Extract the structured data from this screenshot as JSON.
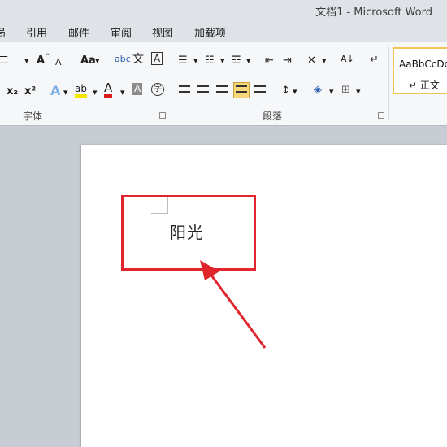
{
  "window": {
    "title": "文档1 - Microsoft Word"
  },
  "tabs": [
    "局",
    "引用",
    "邮件",
    "审阅",
    "视图",
    "加载项"
  ],
  "ribbon": {
    "font_group": {
      "label": "字体",
      "font_size": "二",
      "grow_font": "A",
      "shrink_font": "A",
      "change_case": "Aa",
      "subscript": "x₂",
      "superscript": "x²",
      "font_color": "A"
    },
    "paragraph_group": {
      "label": "段落"
    },
    "styles_group": {
      "sample": "AaBbCcDd",
      "style_name": "↵ 正文"
    }
  },
  "document": {
    "text": "阳光"
  },
  "colors": {
    "annotation": "#e0262c",
    "ribbon_bg": "#f6f7f9",
    "page_bg": "#ffffff"
  }
}
